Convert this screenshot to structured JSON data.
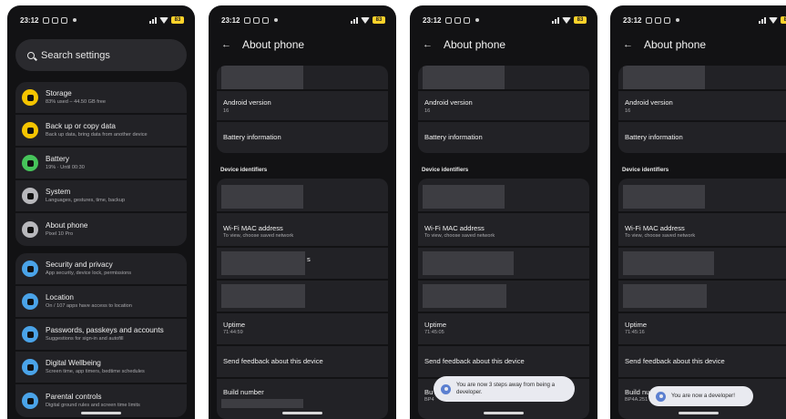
{
  "status": {
    "time": "23:12",
    "battery": "83"
  },
  "settings": {
    "search_placeholder": "Search settings",
    "items": [
      {
        "title": "Storage",
        "subtitle": "83% used – 44.50 GB free",
        "icon": "storage-icon",
        "color": "#f5c400"
      },
      {
        "title": "Back up or copy data",
        "subtitle": "Back up data, bring data from another device",
        "icon": "backup-icon",
        "color": "#f5c400"
      },
      {
        "title": "Battery",
        "subtitle": "19% · Until 00:30",
        "icon": "battery-icon",
        "color": "#46c45a"
      },
      {
        "title": "System",
        "subtitle": "Languages, gestures, time, backup",
        "icon": "system-icon",
        "color": "#b8b8bc"
      },
      {
        "title": "About phone",
        "subtitle": "Pixel 10 Pro",
        "icon": "phone-icon",
        "color": "#b8b8bc"
      },
      {
        "title": "Security and privacy",
        "subtitle": "App security, device lock, permissions",
        "icon": "shield-icon",
        "color": "#4aa3e8"
      },
      {
        "title": "Location",
        "subtitle": "On / 107 apps have access to location",
        "icon": "location-icon",
        "color": "#4aa3e8"
      },
      {
        "title": "Passwords, passkeys and accounts",
        "subtitle": "Suggestions for sign-in and autofill",
        "icon": "key-icon",
        "color": "#4aa3e8"
      },
      {
        "title": "Digital Wellbeing",
        "subtitle": "Screen time, app timers, bedtime schedules",
        "icon": "wellbeing-icon",
        "color": "#4aa3e8"
      },
      {
        "title": "Parental controls",
        "subtitle": "Digital ground rules and screen time limits",
        "icon": "parental-icon",
        "color": "#4aa3e8"
      }
    ]
  },
  "about": {
    "title": "About phone",
    "android_version_label": "Android version",
    "android_version_value": "16",
    "battery_info_label": "Battery information",
    "device_identifiers_label": "Device identifiers",
    "wifi_mac_label": "Wi-Fi MAC address",
    "wifi_mac_value": "To view, choose saved network",
    "redacted_suffix": "s",
    "uptime_label": "Uptime",
    "uptime_values": [
      "71:44:59",
      "71:45:05",
      "71:45:16"
    ],
    "feedback_label": "Send feedback about this device",
    "build_number_label": "Build number",
    "build_number_partial_3": "BP4",
    "build_number_partial_4": "BP4A.251",
    "build_label_trunc_3": "Bu",
    "build_label_trunc_4": "Build nur"
  },
  "toasts": {
    "steps_away": "You are now 3 steps away from being a developer.",
    "developer": "You are now a developer!"
  }
}
